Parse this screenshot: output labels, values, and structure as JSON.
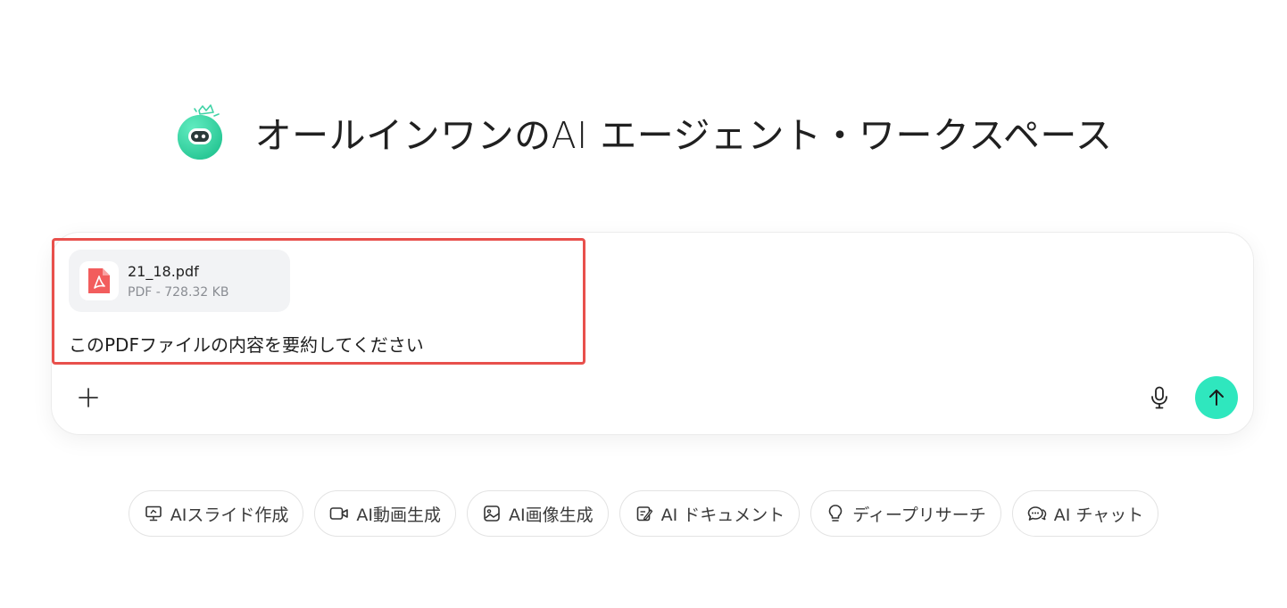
{
  "hero": {
    "title": "オールインワンのAI エージェント・ワークスペース",
    "logo_icon": "robot-mascot-icon"
  },
  "composer": {
    "attachment": {
      "file_name": "21_18.pdf",
      "file_info": "PDF - 728.32 KB",
      "icon": "pdf-icon"
    },
    "prompt": "このPDFファイルの内容を要約してください",
    "plus_icon": "plus-icon",
    "mic_icon": "microphone-icon",
    "send_icon": "arrow-up-icon"
  },
  "chips": [
    {
      "label": "AIスライド作成",
      "icon": "presentation-icon"
    },
    {
      "label": "AI動画生成",
      "icon": "video-camera-icon"
    },
    {
      "label": "AI画像生成",
      "icon": "image-icon"
    },
    {
      "label": "AI ドキュメント",
      "icon": "document-edit-icon"
    },
    {
      "label": "ディープリサーチ",
      "icon": "lightbulb-icon"
    },
    {
      "label": "AI チャット",
      "icon": "chat-bubbles-icon"
    }
  ],
  "colors": {
    "accent": "#2fe7be",
    "highlight_border": "#e8504c",
    "pdf_red": "#f25d5d"
  }
}
